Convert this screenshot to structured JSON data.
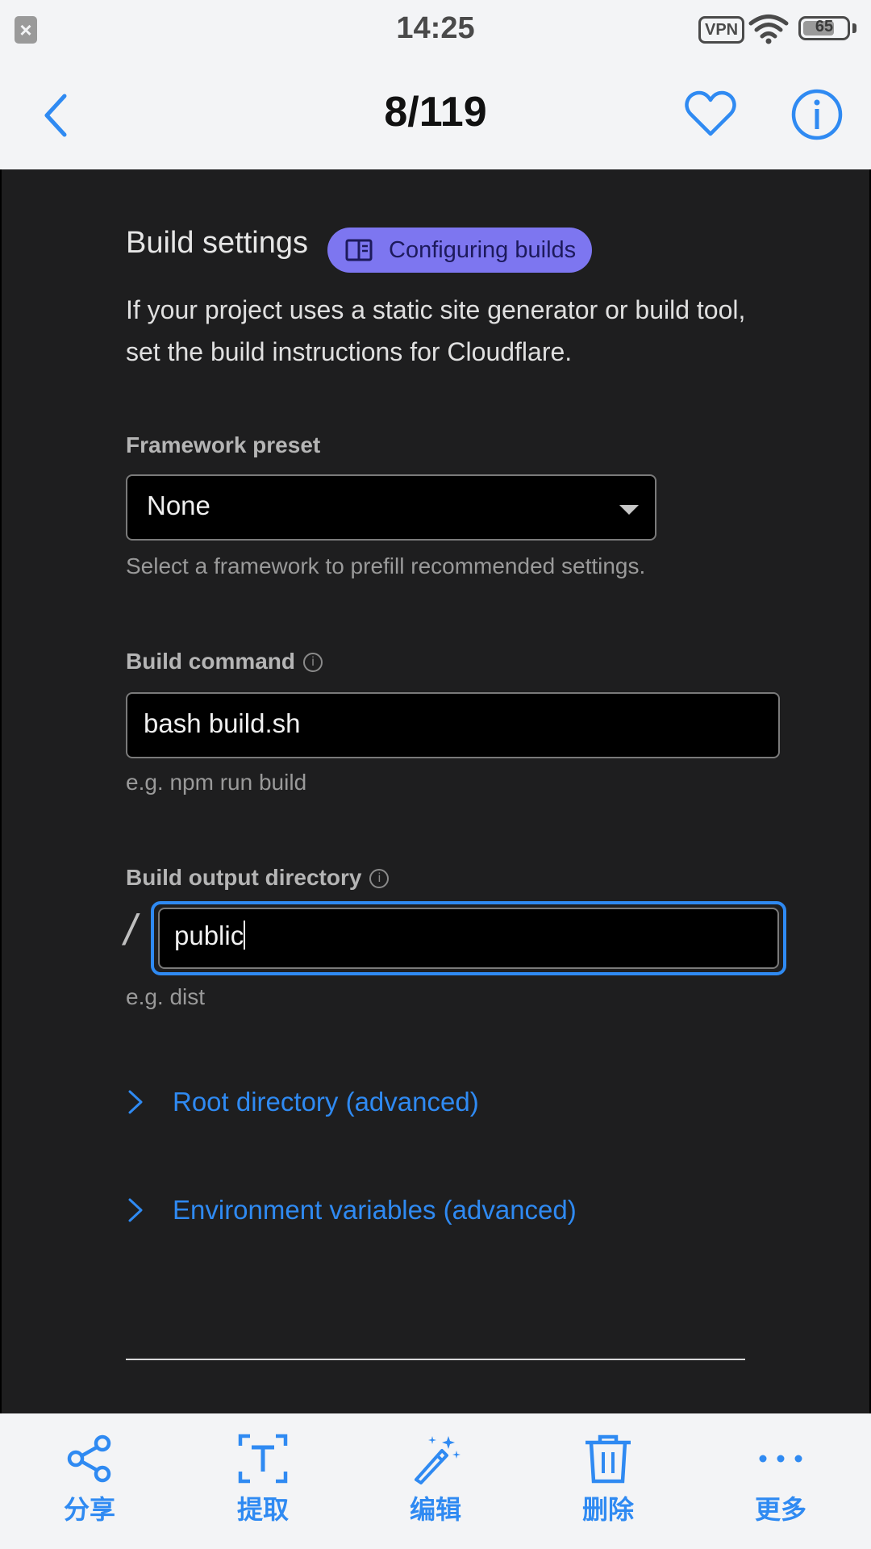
{
  "status_bar": {
    "time": "14:25",
    "vpn_label": "VPN",
    "battery": "65",
    "notification_icon": "close-box-icon"
  },
  "app_bar": {
    "page_counter": "8/119",
    "back_icon": "chevron-left-icon",
    "favorite_icon": "heart-outline-icon",
    "info_icon": "info-circle-icon"
  },
  "content": {
    "section_title": "Build settings",
    "docs_tag": {
      "label": "Configuring builds",
      "icon": "book-icon"
    },
    "intro": "If your project uses a static site generator or build tool, set the build instructions for Cloudflare.",
    "framework": {
      "label": "Framework preset",
      "value": "None",
      "hint": "Select a framework to prefill recommended settings."
    },
    "build_command": {
      "label": "Build command",
      "value": "bash build.sh",
      "hint": "e.g. npm run build"
    },
    "output_dir": {
      "label": "Build output directory",
      "prefix": "/",
      "value": "public",
      "hint": "e.g. dist"
    },
    "advanced": [
      {
        "label": "Root directory (advanced)"
      },
      {
        "label": "Environment variables (advanced)"
      }
    ]
  },
  "bottom_bar": {
    "actions": [
      {
        "label": "分享",
        "icon": "share-icon"
      },
      {
        "label": "提取",
        "icon": "extract-text-icon"
      },
      {
        "label": "编辑",
        "icon": "magic-wand-icon"
      },
      {
        "label": "删除",
        "icon": "trash-icon"
      },
      {
        "label": "更多",
        "icon": "more-dots-icon"
      }
    ]
  },
  "colors": {
    "accent": "#2f8af2",
    "tag_bg": "#7d76f0",
    "content_bg": "#1e1e1f"
  }
}
